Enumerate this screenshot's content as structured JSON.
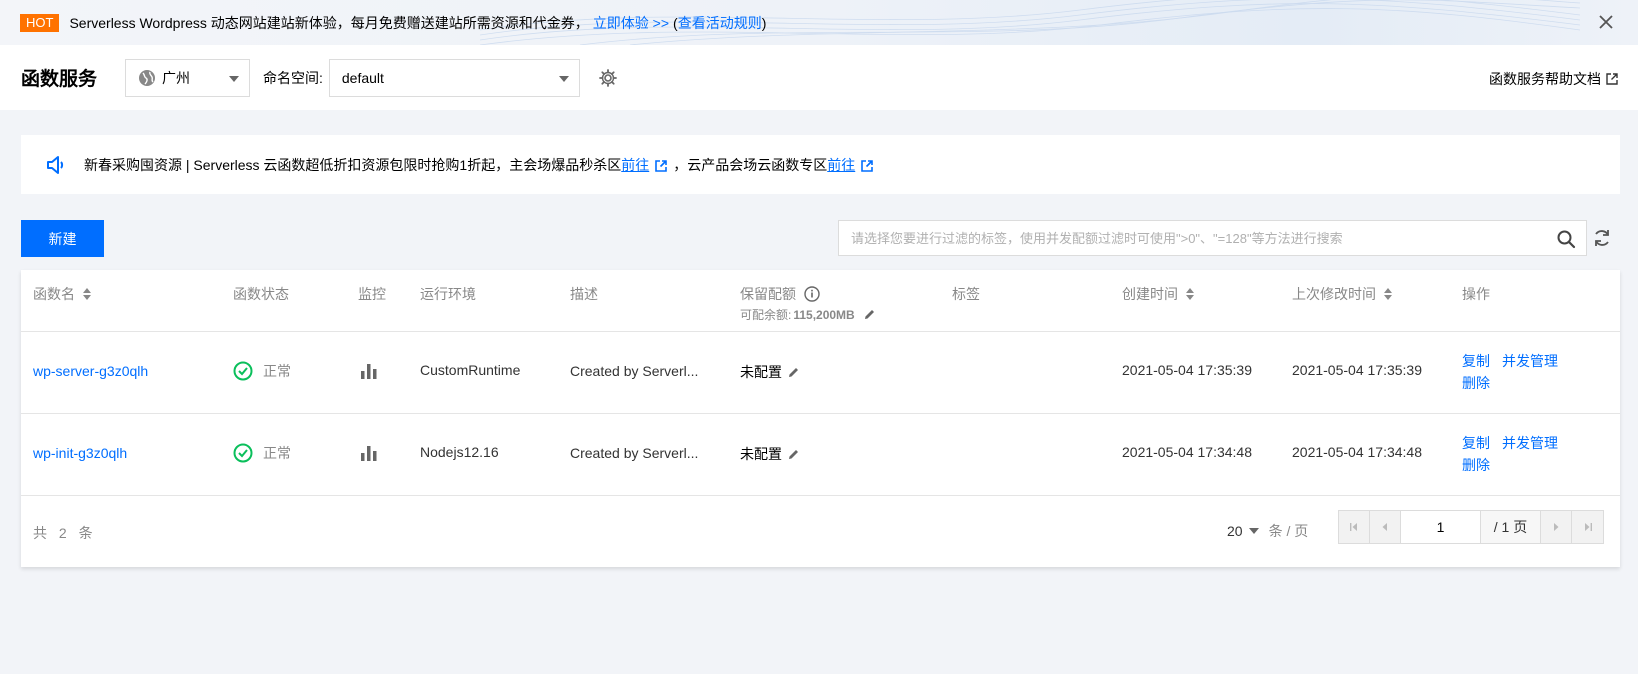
{
  "banner": {
    "badge": "HOT",
    "text": "Serverless Wordpress 动态网站建站新体验，每月免费赠送建站所需资源和代金券，",
    "link": "立即体验 >>",
    "paren_open": "(",
    "rules_link": "查看活动规则",
    "paren_close": ")",
    "close_icon": "close-icon"
  },
  "header": {
    "title": "函数服务",
    "region": "广州",
    "namespace_label": "命名空间:",
    "namespace_value": "default",
    "help_link": "函数服务帮助文档"
  },
  "notice": {
    "text1": "新春采购囤资源 | Serverless 云函数超低折扣资源包限时抢购1折起，主会场爆品秒杀区",
    "link1": "前往",
    "text2": "，云产品会场云函数专区",
    "link2": "前往"
  },
  "toolbar": {
    "new_button": "新建",
    "search_placeholder": "请选择您要进行过滤的标签，使用并发配额过滤时可使用\">0\"、\"=128\"等方法进行搜索"
  },
  "table": {
    "columns": {
      "name": "函数名",
      "status": "函数状态",
      "monitor": "监控",
      "runtime": "运行环境",
      "desc": "描述",
      "reserved": "保留配额",
      "reserved_sub_label": "可配余额:",
      "reserved_sub_value": "115,200MB",
      "tags": "标签",
      "created": "创建时间",
      "modified": "上次修改时间",
      "ops": "操作"
    },
    "rows": [
      {
        "name": "wp-server-g3z0qlh",
        "status": "正常",
        "runtime": "CustomRuntime",
        "desc": "Created by Serverl...",
        "reserved": "未配置",
        "created": "2021-05-04 17:35:39",
        "modified": "2021-05-04 17:35:39",
        "op_copy": "复制",
        "op_concurrency": "并发管理",
        "op_delete": "删除"
      },
      {
        "name": "wp-init-g3z0qlh",
        "status": "正常",
        "runtime": "Nodejs12.16",
        "desc": "Created by Serverl...",
        "reserved": "未配置",
        "created": "2021-05-04 17:34:48",
        "modified": "2021-05-04 17:34:48",
        "op_copy": "复制",
        "op_concurrency": "并发管理",
        "op_delete": "删除"
      }
    ],
    "total": "共 2 条",
    "page_size": "20",
    "page_size_unit": "条 / 页",
    "current_page": "1",
    "total_pages": "/ 1 页"
  },
  "colors": {
    "primary": "#006eff",
    "hot": "#ff7200",
    "status_ok": "#0abf5b"
  }
}
